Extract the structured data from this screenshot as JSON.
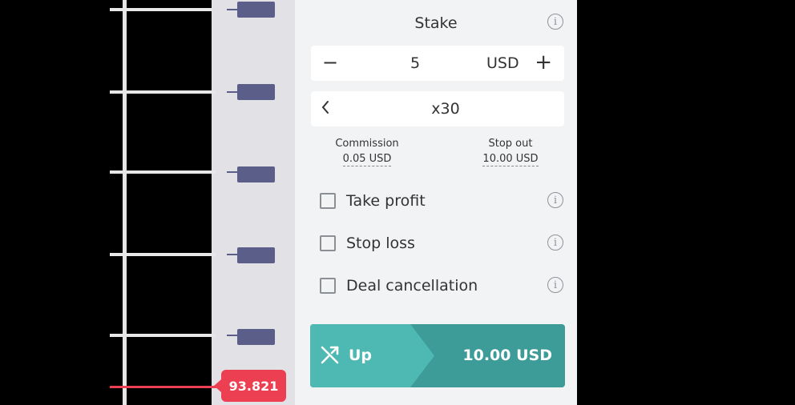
{
  "chart": {
    "current_price": "93.821",
    "price_line_color": "#ec3f52"
  },
  "trade_panel": {
    "stake": {
      "title": "Stake",
      "amount": "5",
      "currency": "USD",
      "decrease_symbol": "−",
      "increase_symbol": "+"
    },
    "multiplier": {
      "value": "x30"
    },
    "commission": {
      "label": "Commission",
      "value": "0.05 USD"
    },
    "stop_out": {
      "label": "Stop out",
      "value": "10.00 USD"
    },
    "options": [
      {
        "label": "Take profit",
        "checked": false
      },
      {
        "label": "Stop loss",
        "checked": false
      },
      {
        "label": "Deal cancellation",
        "checked": false
      }
    ],
    "purchase_button": {
      "label": "Up",
      "amount": "10.00 USD",
      "icon": "shuffle-up-arrow-icon",
      "color": "#4eb9b2",
      "dark_color": "#3d9c98"
    },
    "info_icon": "info-icon"
  }
}
